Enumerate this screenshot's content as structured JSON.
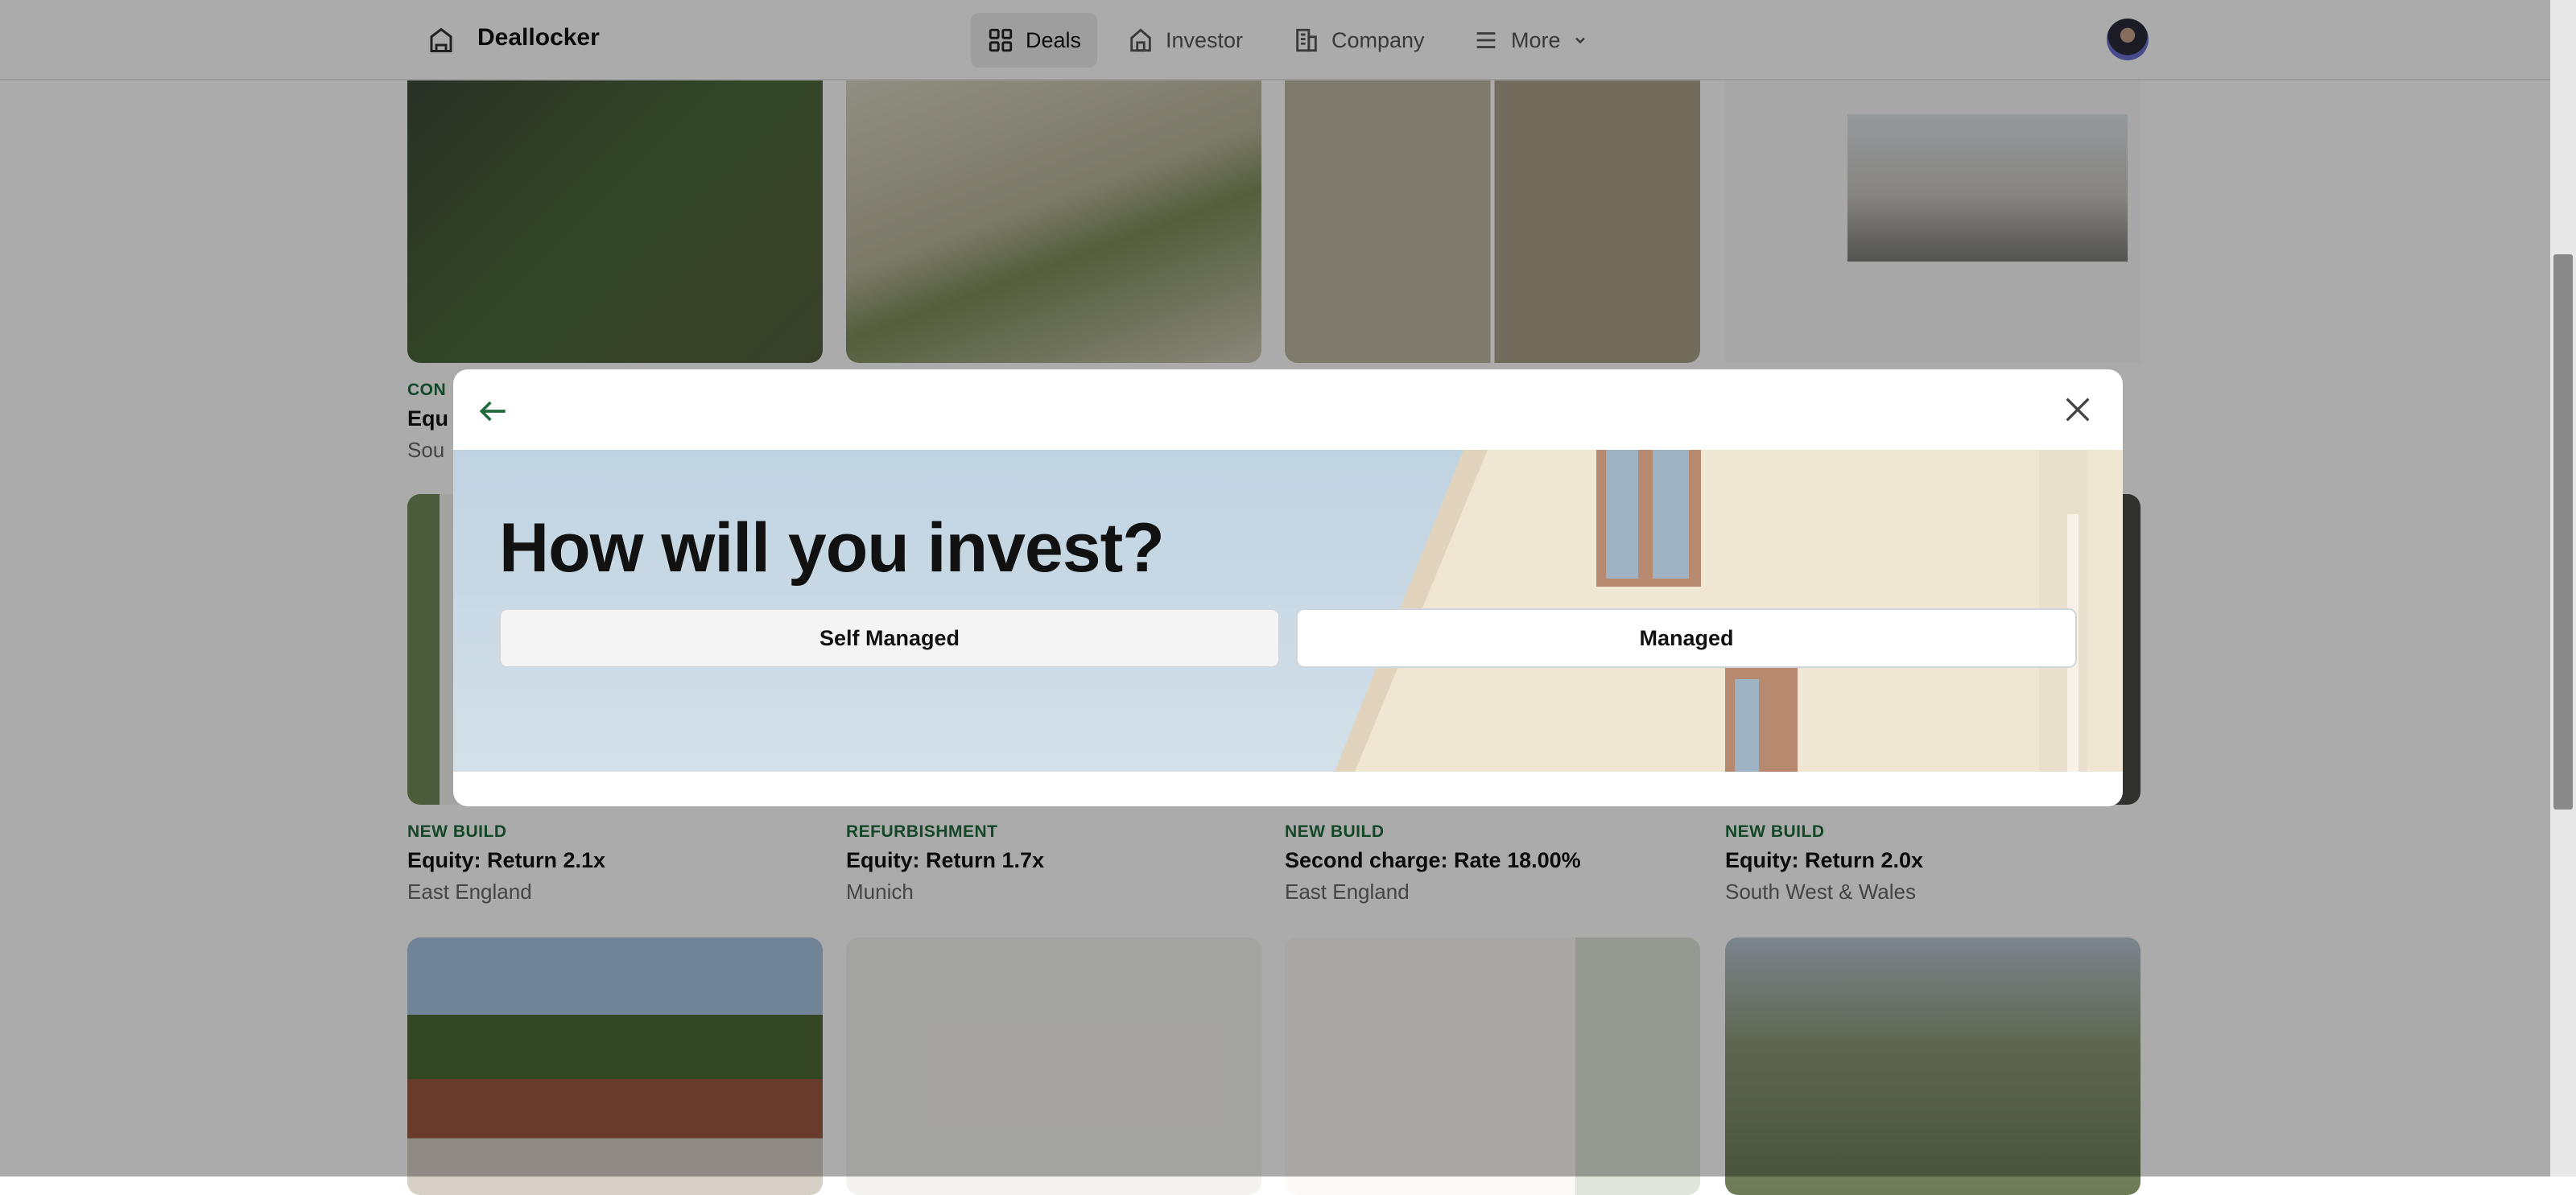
{
  "nav": {
    "brand": "Deallocker",
    "items": [
      {
        "label": "Deals",
        "icon": "grid-icon",
        "active": true
      },
      {
        "label": "Investor",
        "icon": "house-icon"
      },
      {
        "label": "Company",
        "icon": "building-icon"
      },
      {
        "label": "More",
        "icon": "menu-icon"
      }
    ]
  },
  "deals": {
    "row1": [
      {
        "category": "CON",
        "title": "Equ",
        "location": "Sou"
      }
    ],
    "row2": [
      {
        "category": "NEW BUILD",
        "title": "Equity: Return 2.1x",
        "location": "East England"
      },
      {
        "category": "REFURBISHMENT",
        "title": "Equity: Return 1.7x",
        "location": "Munich"
      },
      {
        "category": "NEW BUILD",
        "title": "Second charge: Rate 18.00%",
        "location": "East England"
      },
      {
        "category": "NEW BUILD",
        "title": "Equity: Return 2.0x",
        "location": "South West & Wales"
      }
    ]
  },
  "modal": {
    "heading": "How will you invest?",
    "options": [
      "Self Managed",
      "Managed"
    ]
  },
  "colors": {
    "accent": "#1e6b3c",
    "overlay": "rgba(0,0,0,0.33)"
  }
}
